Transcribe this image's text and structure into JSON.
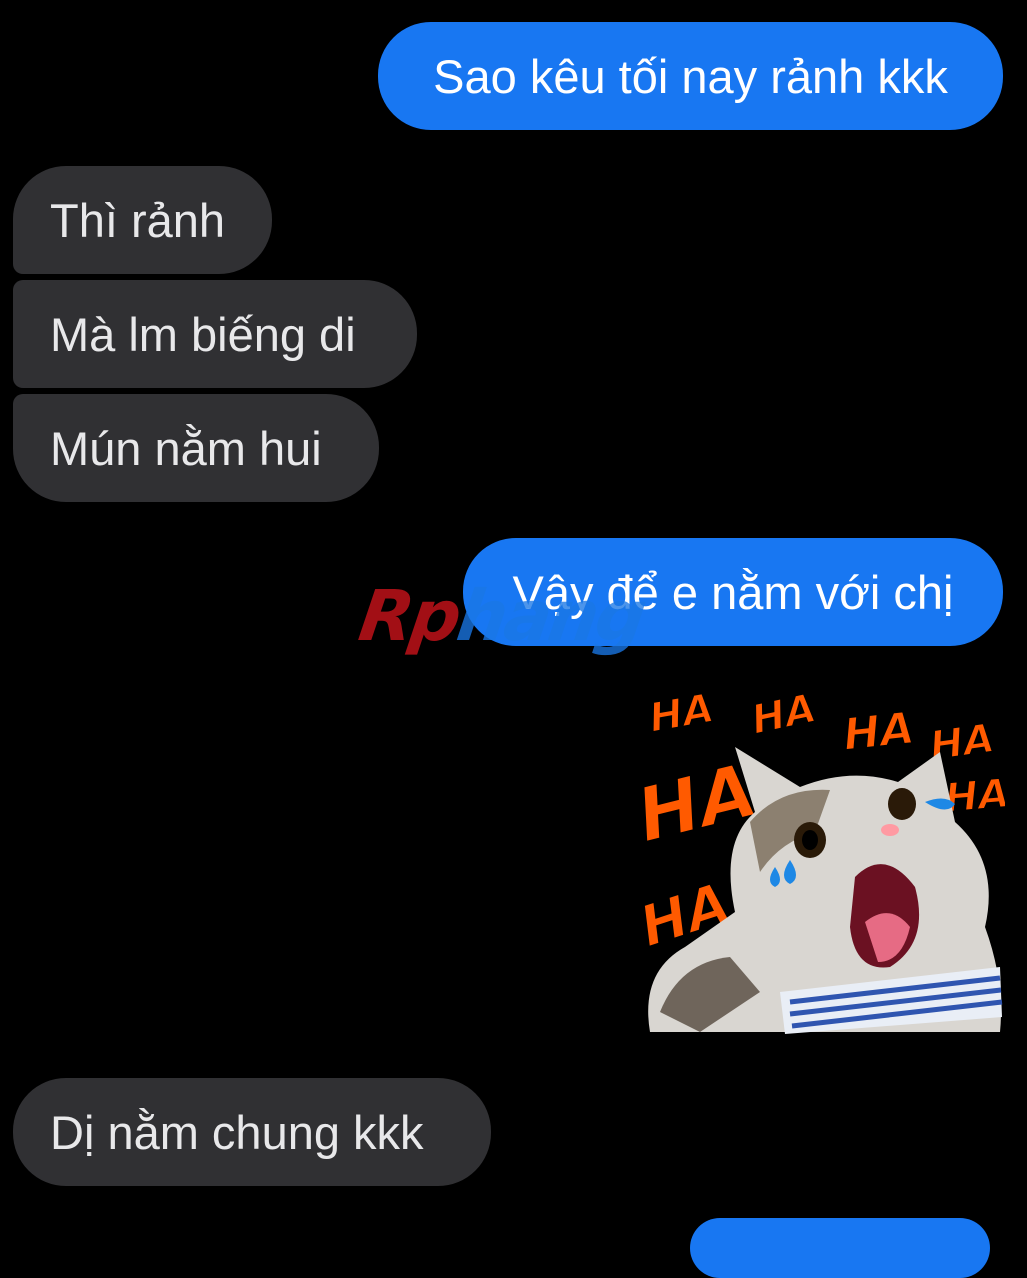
{
  "messages": [
    {
      "id": "m1",
      "side": "sent",
      "text": "Sao kêu tối nay rảnh kkk"
    },
    {
      "id": "m2",
      "side": "received",
      "text": "Thì rảnh"
    },
    {
      "id": "m3",
      "side": "received",
      "text": "Mà lm biếng di"
    },
    {
      "id": "m4",
      "side": "received",
      "text": "Mún nằm hui"
    },
    {
      "id": "m5",
      "side": "sent",
      "text": "Vậy để e nằm với chị"
    },
    {
      "id": "m6",
      "side": "sent",
      "type": "sticker",
      "sticker": "laughing-crying-cat-sticker",
      "words": [
        "HA",
        "HA",
        "HA",
        "HA",
        "HA",
        "HA",
        "HA"
      ]
    },
    {
      "id": "m7",
      "side": "received",
      "text": "Dị nằm chung kkk"
    },
    {
      "id": "m8",
      "side": "sent",
      "text": ""
    }
  ],
  "watermark": {
    "part1": "Rp",
    "part2": "hang"
  },
  "colors": {
    "sent_bubble": "#1877f2",
    "received_bubble": "#303033",
    "background": "#000000",
    "ha_text": "#ff5a00"
  }
}
